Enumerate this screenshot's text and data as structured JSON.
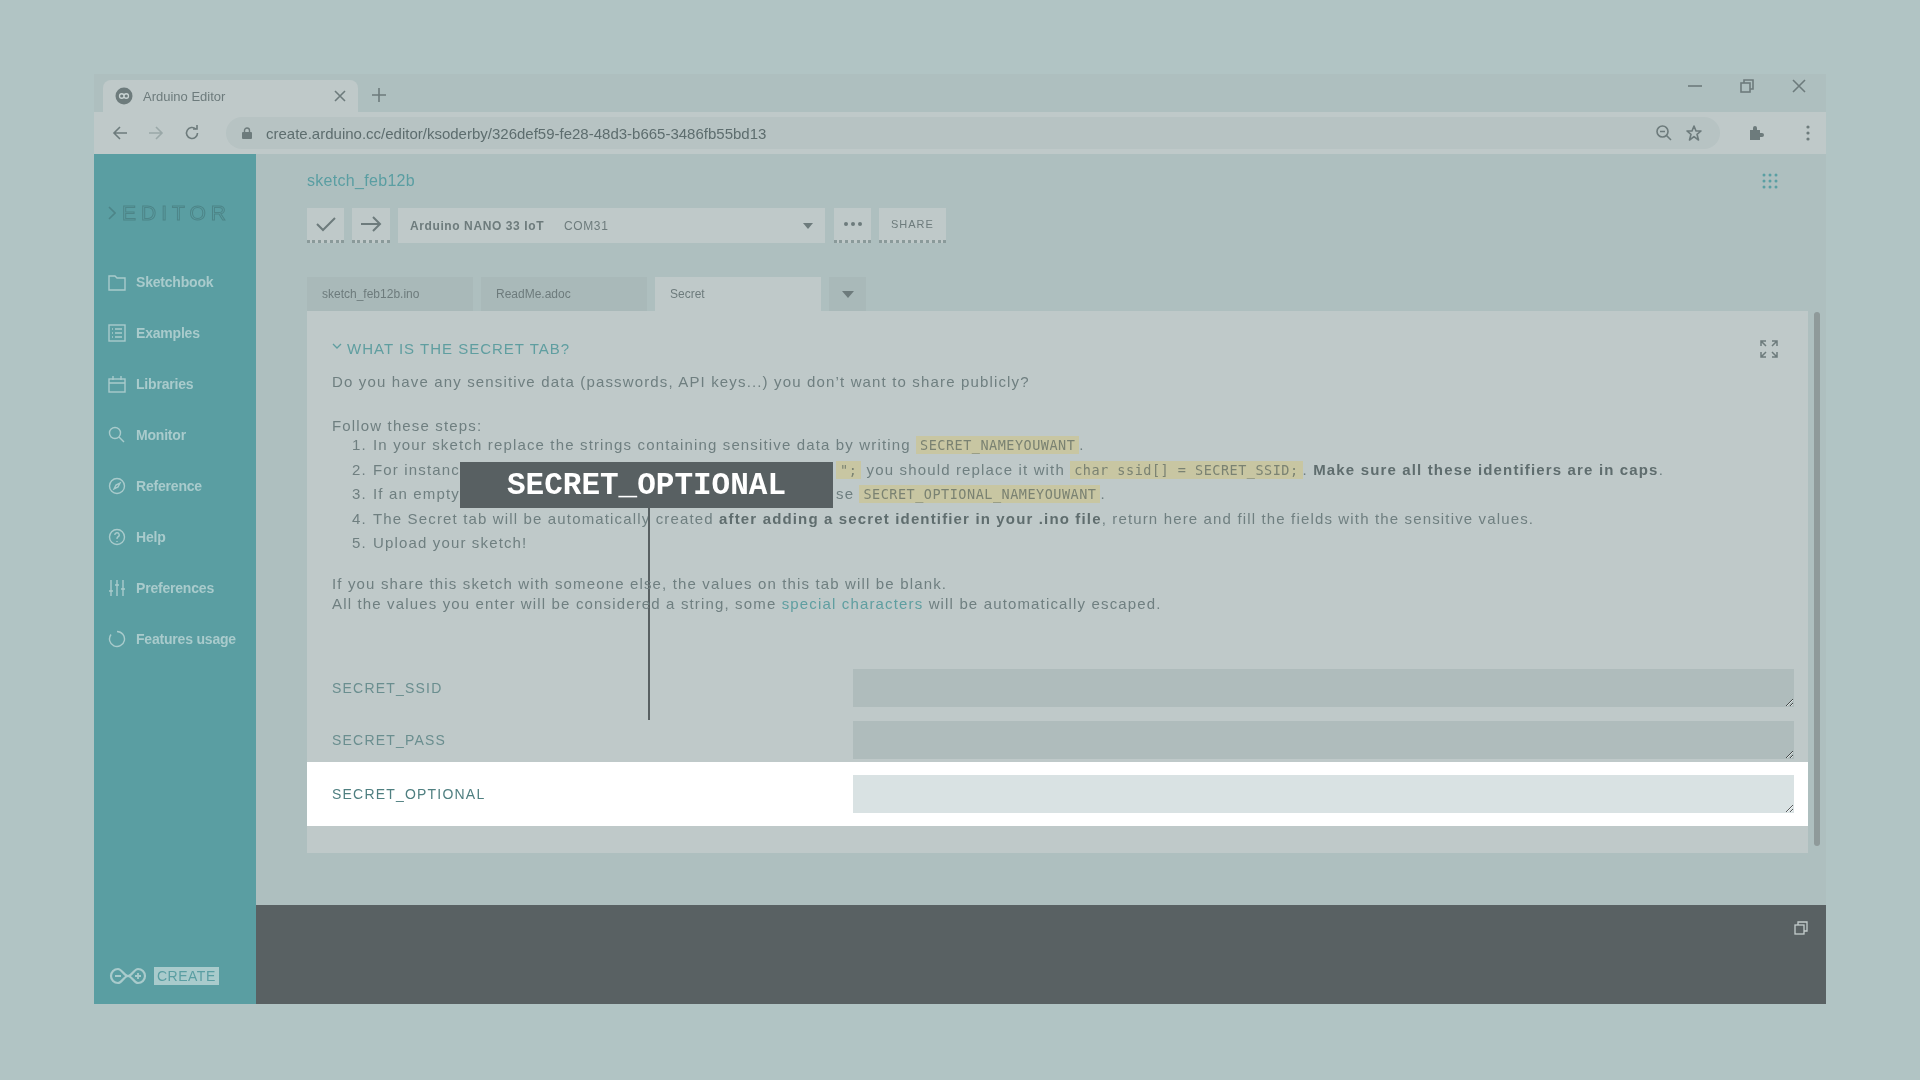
{
  "browser": {
    "tab_title": "Arduino Editor",
    "url": "create.arduino.cc/editor/ksoderby/326def59-fe28-48d3-b665-3486fb55bd13"
  },
  "sidebar": {
    "logo": "EDITOR",
    "items": [
      {
        "label": "Sketchbook"
      },
      {
        "label": "Examples"
      },
      {
        "label": "Libraries"
      },
      {
        "label": "Monitor"
      },
      {
        "label": "Reference"
      },
      {
        "label": "Help"
      },
      {
        "label": "Preferences"
      },
      {
        "label": "Features usage"
      }
    ],
    "footer": "CREATE"
  },
  "sketch_title": "sketch_feb12b",
  "toolbar": {
    "board": "Arduino NANO 33 IoT",
    "port": "COM31",
    "share": "SHARE"
  },
  "file_tabs": [
    {
      "label": "sketch_feb12b.ino",
      "selected": false
    },
    {
      "label": "ReadMe.adoc",
      "selected": false
    },
    {
      "label": "Secret",
      "selected": true
    }
  ],
  "secret_tab": {
    "heading": "WHAT IS THE SECRET TAB?",
    "expanded": true,
    "intro": "Do you have any sensitive data (passwords, API keys...) you don’t want to share publicly?",
    "steps_label": "Follow these steps:",
    "steps": [
      {
        "number": "1.",
        "fragments": [
          [
            {
              "kind": "text",
              "text": "In your sketch replace the strings containing sensitive data by writing "
            },
            {
              "kind": "code",
              "text": "SECRET_NAMEYOUWANT"
            },
            {
              "kind": "text",
              "text": "."
            }
          ]
        ]
      },
      {
        "number": "2.",
        "fragments": [
          [
            {
              "kind": "text",
              "text": "For instanc"
            }
          ],
          [
            {
              "kind": "code",
              "text": "\";"
            },
            {
              "kind": "text",
              "text": " you should replace it with "
            },
            {
              "kind": "code",
              "text": "char ssid[] = SECRET_SSID;"
            },
            {
              "kind": "text",
              "text": ". "
            },
            {
              "kind": "bold",
              "text": "Make sure all these identifiers are in caps"
            },
            {
              "kind": "text",
              "text": "."
            }
          ]
        ]
      },
      {
        "number": "3.",
        "fragments": [
          [
            {
              "kind": "text",
              "text": "If an empty"
            }
          ],
          [
            {
              "kind": "text",
              "text": "se "
            },
            {
              "kind": "code",
              "text": "SECRET_OPTIONAL_NAMEYOUWANT"
            },
            {
              "kind": "text",
              "text": "."
            }
          ]
        ]
      },
      {
        "number": "4.",
        "fragments": [
          [
            {
              "kind": "text",
              "text": "The Secret tab will be automatically created "
            },
            {
              "kind": "bold",
              "text": "after adding a secret identifier in your .ino file"
            },
            {
              "kind": "text",
              "text": ", return here and fill the fields with the sensitive values."
            }
          ]
        ]
      },
      {
        "number": "5.",
        "fragments": [
          [
            {
              "kind": "text",
              "text": "Upload your sketch!"
            }
          ]
        ]
      }
    ],
    "notes": [
      [
        {
          "kind": "text",
          "text": "If you share this sketch with someone else, the values on this tab will be blank."
        }
      ],
      [
        {
          "kind": "text",
          "text": "All the values you enter will be considered a string, some "
        },
        {
          "kind": "link",
          "text": "special characters"
        },
        {
          "kind": "text",
          "text": " will be automatically escaped."
        }
      ]
    ],
    "fields": [
      {
        "label": "SECRET_SSID",
        "highlighted": false
      },
      {
        "label": "SECRET_PASS",
        "highlighted": false
      },
      {
        "label": "SECRET_OPTIONAL",
        "highlighted": true
      }
    ]
  },
  "callout": {
    "text": "SECRET_OPTIONAL"
  }
}
